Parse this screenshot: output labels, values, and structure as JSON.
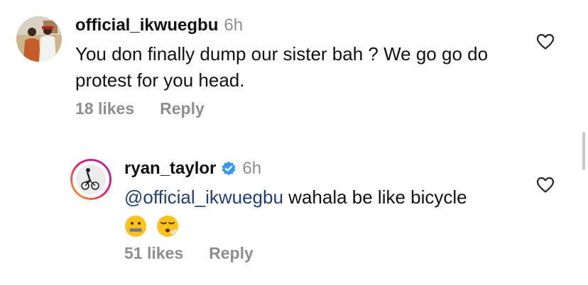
{
  "comments": [
    {
      "username": "official_ikwuegbu",
      "time": "6h",
      "text": "You don finally dump our sister bah ? We go go do protest for you head.",
      "likes": "18 likes",
      "reply": "Reply"
    },
    {
      "username": "ryan_taylor",
      "time": "6h",
      "mention": "@official_ikwuegbu",
      "text": " wahala be like bicycle",
      "emojis": [
        "zipper-mouth-face",
        "face-exhaling"
      ],
      "likes": "51 likes",
      "reply": "Reply"
    }
  ],
  "icons": {
    "like": "heart-outline-icon",
    "verified": "verified-badge-icon"
  },
  "colors": {
    "text": "#111111",
    "muted": "#8e8e8e",
    "mention": "#1f3f7a",
    "verified": "#3897f0"
  }
}
